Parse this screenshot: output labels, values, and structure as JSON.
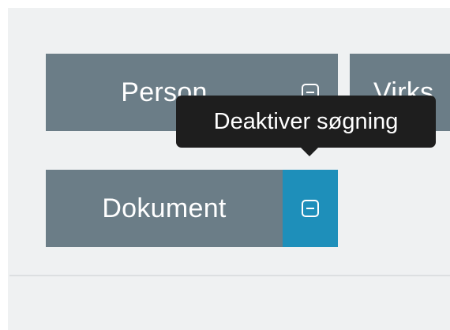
{
  "tiles": {
    "person": {
      "label": "Person",
      "toggle_icon": "minus-square-icon"
    },
    "virks": {
      "label": "Virks"
    },
    "dokument": {
      "label": "Dokument",
      "toggle_icon": "minus-square-icon",
      "toggle_active": true
    }
  },
  "tooltip": {
    "text": "Deaktiver søgning"
  },
  "colors": {
    "background": "#eff1f2",
    "tile": "#6b7d87",
    "toggle_active": "#1e8fba",
    "tooltip": "#1e1e1e",
    "text": "#ffffff"
  }
}
